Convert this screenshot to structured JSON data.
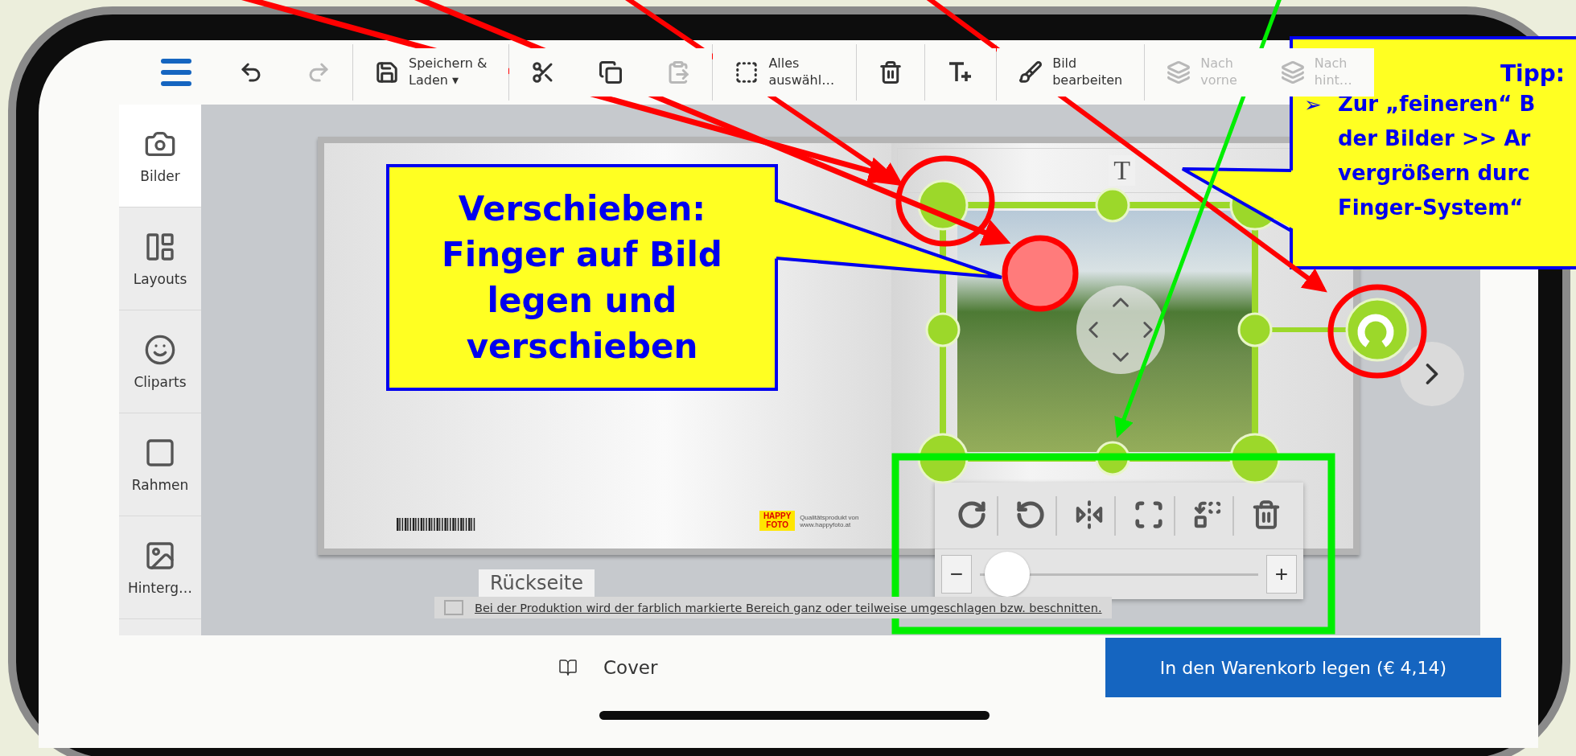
{
  "toolbar": [
    {
      "kind": "menu",
      "disabled": false
    },
    {
      "kind": "undo",
      "disabled": false
    },
    {
      "kind": "redo",
      "disabled": true
    },
    {
      "kind": "divider"
    },
    {
      "kind": "save",
      "label": "Speichern &",
      "label2": "Laden ▾",
      "disabled": false
    },
    {
      "kind": "divider"
    },
    {
      "kind": "cut",
      "disabled": false
    },
    {
      "kind": "copy",
      "disabled": false
    },
    {
      "kind": "paste",
      "disabled": true
    },
    {
      "kind": "divider"
    },
    {
      "kind": "select_all",
      "label": "Alles",
      "label2": "auswähl…",
      "disabled": false
    },
    {
      "kind": "divider"
    },
    {
      "kind": "delete",
      "disabled": false
    },
    {
      "kind": "divider"
    },
    {
      "kind": "add_text",
      "disabled": false
    },
    {
      "kind": "divider"
    },
    {
      "kind": "edit_image",
      "label": "Bild",
      "label2": "bearbeiten",
      "disabled": false
    },
    {
      "kind": "divider"
    },
    {
      "kind": "forward",
      "label": "Nach",
      "label2": "vorne",
      "disabled": true
    },
    {
      "kind": "backward",
      "label": "Nach",
      "label2": "hint…",
      "disabled": true
    }
  ],
  "sidebar": [
    {
      "kind": "images",
      "label": "Bilder",
      "selected": true
    },
    {
      "kind": "layouts",
      "label": "Layouts",
      "selected": false
    },
    {
      "kind": "cliparts",
      "label": "Cliparts",
      "selected": false
    },
    {
      "kind": "frames",
      "label": "Rahmen",
      "selected": false
    },
    {
      "kind": "background",
      "label": "Hinterg…",
      "selected": false
    }
  ],
  "book": {
    "text_placeholder": "T",
    "logo": "HAPPY FOTO",
    "logo_caption": "Qualitätsprodukt von",
    "logo_url": "www.happyfoto.at",
    "page_label": "Rückseite"
  },
  "notice": {
    "checked": false,
    "text": "Bei der Produktion wird der farblich markierte Bereich ganz oder teilweise umgeschlagen bzw. beschnitten."
  },
  "image_tools": {
    "minus": "−",
    "plus": "+",
    "zoom": {
      "level": 0.04
    }
  },
  "bottom_bar": {
    "cover": "Cover",
    "cart_button": "In den Warenkorb legen (€ 4,14)"
  },
  "callouts": [
    {
      "kind": "move",
      "lines": [
        "Verschieben:",
        "Finger auf Bild",
        "legen und",
        "verschieben"
      ]
    },
    {
      "kind": "tip",
      "title": "Tipp:",
      "bullet": "➢",
      "lines": [
        "Zur „feineren“ B",
        "der Bilder >> Ar",
        "vergrößern durc",
        "Finger-System“"
      ]
    }
  ]
}
